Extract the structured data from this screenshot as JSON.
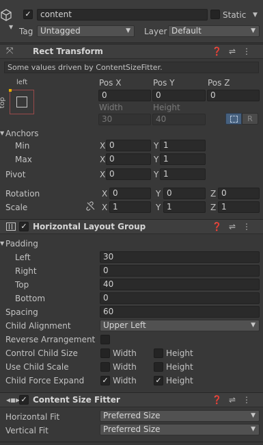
{
  "gameobject": {
    "name": "content",
    "static_label": "Static",
    "tag_label": "Tag",
    "tag_value": "Untagged",
    "layer_label": "Layer",
    "layer_value": "Default"
  },
  "rect_transform": {
    "title": "Rect Transform",
    "info": "Some values driven by ContentSizeFitter.",
    "anchor_preset_h": "left",
    "anchor_preset_v": "top",
    "pos_x_label": "Pos X",
    "pos_y_label": "Pos Y",
    "pos_z_label": "Pos Z",
    "pos_x": "0",
    "pos_y": "0",
    "pos_z": "0",
    "width_label": "Width",
    "height_label": "Height",
    "width": "30",
    "height": "40",
    "raw_btn": "R",
    "anchors_label": "Anchors",
    "min_label": "Min",
    "max_label": "Max",
    "min_x": "0",
    "min_y": "1",
    "max_x": "0",
    "max_y": "1",
    "pivot_label": "Pivot",
    "pivot_x": "0",
    "pivot_y": "1",
    "rotation_label": "Rotation",
    "rot_x": "0",
    "rot_y": "0",
    "rot_z": "0",
    "scale_label": "Scale",
    "scale_x": "1",
    "scale_y": "1",
    "scale_z": "1",
    "x": "X",
    "y": "Y",
    "z": "Z"
  },
  "hlg": {
    "title": "Horizontal Layout Group",
    "padding_label": "Padding",
    "left_label": "Left",
    "left": "30",
    "right_label": "Right",
    "right": "0",
    "top_label": "Top",
    "top": "40",
    "bottom_label": "Bottom",
    "bottom": "0",
    "spacing_label": "Spacing",
    "spacing": "60",
    "child_alignment_label": "Child Alignment",
    "child_alignment": "Upper Left",
    "reverse_label": "Reverse Arrangement",
    "control_label": "Control Child Size",
    "use_scale_label": "Use Child Scale",
    "expand_label": "Child Force Expand",
    "width_label": "Width",
    "height_label": "Height"
  },
  "csf": {
    "title": "Content Size Fitter",
    "hfit_label": "Horizontal Fit",
    "hfit": "Preferred Size",
    "vfit_label": "Vertical Fit",
    "vfit": "Preferred Size"
  }
}
